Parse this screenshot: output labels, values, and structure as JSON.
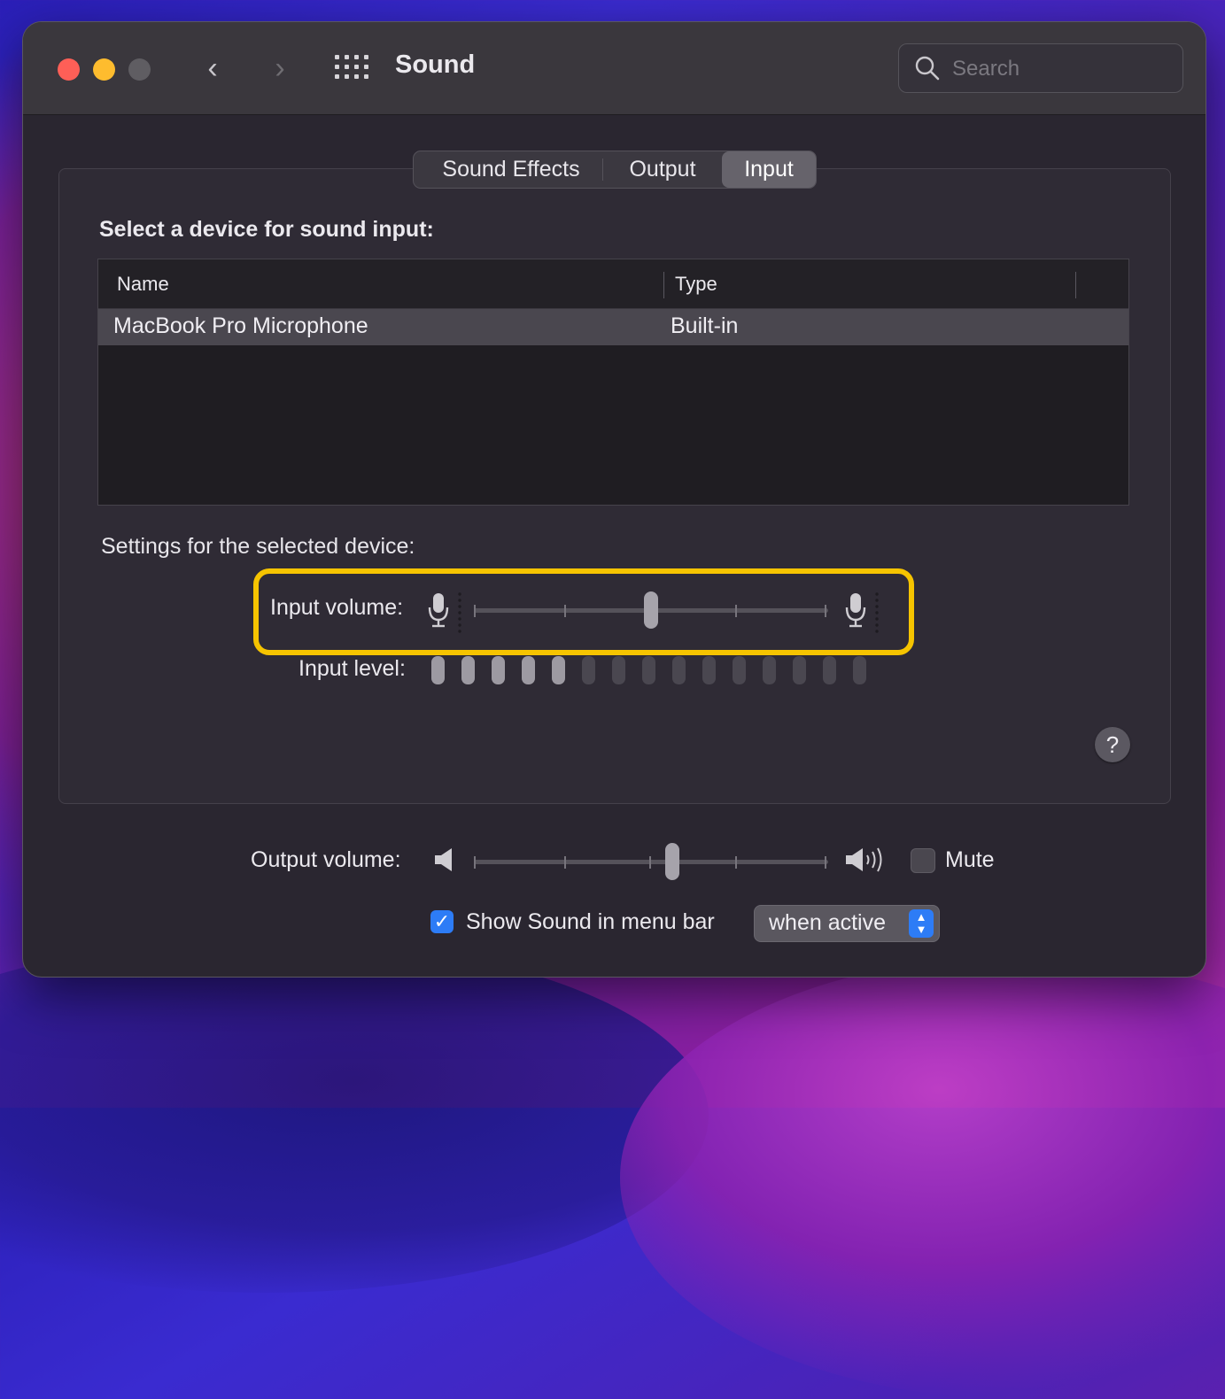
{
  "window": {
    "title": "Sound",
    "search_placeholder": "Search"
  },
  "tabs": [
    {
      "label": "Sound Effects",
      "selected": false
    },
    {
      "label": "Output",
      "selected": false
    },
    {
      "label": "Input",
      "selected": true
    }
  ],
  "input_section": {
    "heading": "Select a device for sound input:",
    "columns": [
      "Name",
      "Type"
    ],
    "devices": [
      {
        "name": "MacBook Pro Microphone",
        "type": "Built-in",
        "selected": true
      }
    ]
  },
  "device_settings": {
    "heading": "Settings for the selected device:",
    "input_volume_label": "Input volume:",
    "input_volume_value": 0.5,
    "input_level_label": "Input level:",
    "input_level_total": 15,
    "input_level_active": 5
  },
  "output": {
    "label": "Output volume:",
    "volume_value": 0.56,
    "mute_label": "Mute",
    "muted": false
  },
  "menu_bar": {
    "show_label": "Show Sound in menu bar",
    "checked": true,
    "mode": "when active"
  },
  "help_label": "?",
  "colors": {
    "highlight": "#f6c400",
    "accent": "#2d7cf6"
  }
}
